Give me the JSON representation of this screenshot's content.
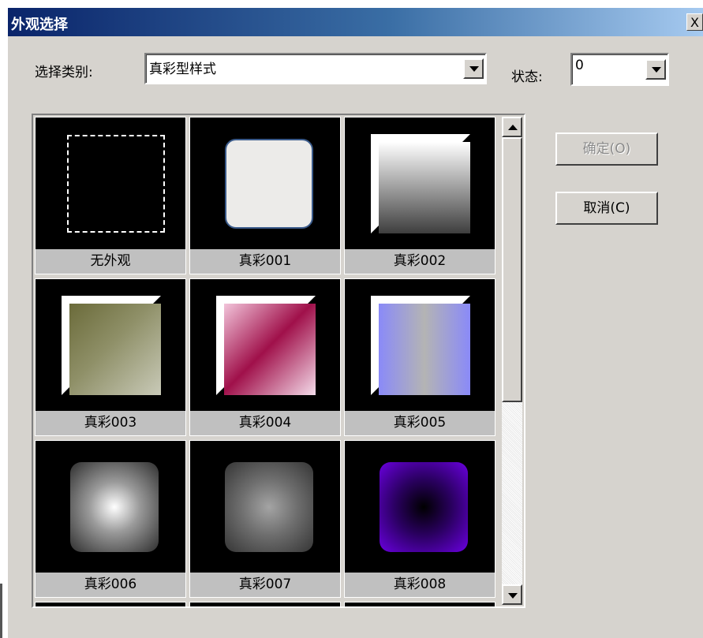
{
  "dialog": {
    "title": "外观选择",
    "close_label": "X"
  },
  "category": {
    "label": "选择类别:",
    "value": "真彩型样式"
  },
  "state": {
    "label": "状态:",
    "value": "0"
  },
  "buttons": {
    "ok_label": "确定(O)",
    "cancel_label": "取消(C)"
  },
  "items": [
    {
      "label": "无外观",
      "style": "none"
    },
    {
      "label": "真彩001",
      "style": "rounded-white",
      "colors": [
        "#ffffff",
        "#e8e8e6"
      ]
    },
    {
      "label": "真彩002",
      "style": "bevel-gradient",
      "colors": [
        "#ffffff",
        "#4a4a4a"
      ]
    },
    {
      "label": "真彩003",
      "style": "bevel-gradient",
      "colors": [
        "#6b6b3a",
        "#c7c8b5"
      ]
    },
    {
      "label": "真彩004",
      "style": "bevel-gradient",
      "colors": [
        "#e8a6c6",
        "#a0104a",
        "#f2d8e6"
      ]
    },
    {
      "label": "真彩005",
      "style": "bevel-gradient",
      "colors": [
        "#8a8af8",
        "#b0b0b0",
        "#8a8af8"
      ]
    },
    {
      "label": "真彩006",
      "style": "radial",
      "colors": [
        "#ffffff",
        "#303030"
      ]
    },
    {
      "label": "真彩007",
      "style": "radial",
      "colors": [
        "#a0a0a0",
        "#383838"
      ]
    },
    {
      "label": "真彩008",
      "style": "radial",
      "colors": [
        "#000000",
        "#6a00e0"
      ]
    }
  ]
}
